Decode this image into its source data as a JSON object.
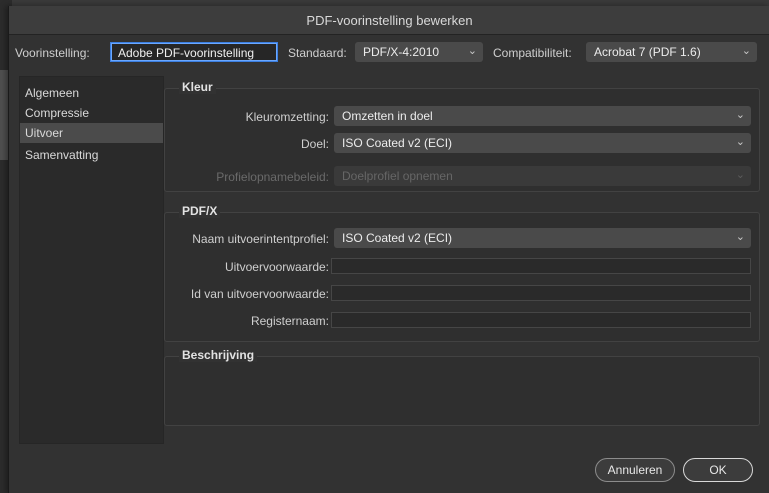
{
  "window": {
    "title": "PDF-voorinstelling bewerken"
  },
  "top": {
    "preset_label": "Voorinstelling:",
    "preset_value": "Adobe PDF-voorinstelling",
    "standard_label": "Standaard:",
    "standard_value": "PDF/X-4:2010",
    "compat_label": "Compatibiliteit:",
    "compat_value": "Acrobat 7 (PDF 1.6)"
  },
  "sidebar": {
    "items": [
      {
        "label": "Algemeen"
      },
      {
        "label": "Compressie"
      },
      {
        "label": "Uitvoer",
        "selected": true
      },
      {
        "label": "Samenvatting"
      }
    ]
  },
  "kleur": {
    "title": "Kleur",
    "conversion_label": "Kleuromzetting:",
    "conversion_value": "Omzetten in doel",
    "target_label": "Doel:",
    "target_value": "ISO Coated v2 (ECI)",
    "profile_policy_label": "Profielopnamebeleid:",
    "profile_policy_value": "Doelprofiel opnemen"
  },
  "pdfx": {
    "title": "PDF/X",
    "intent_label": "Naam uitvoerintentprofiel:",
    "intent_value": "ISO Coated v2 (ECI)",
    "condition_label": "Uitvoervoorwaarde:",
    "condition_value": "",
    "condition_id_label": "Id van uitvoervoorwaarde:",
    "condition_id_value": "",
    "registry_label": "Registernaam:",
    "registry_value": ""
  },
  "description": {
    "title": "Beschrijving"
  },
  "buttons": {
    "cancel": "Annuleren",
    "ok": "OK"
  },
  "icons": {
    "dropdown": "chevron-down-icon"
  }
}
